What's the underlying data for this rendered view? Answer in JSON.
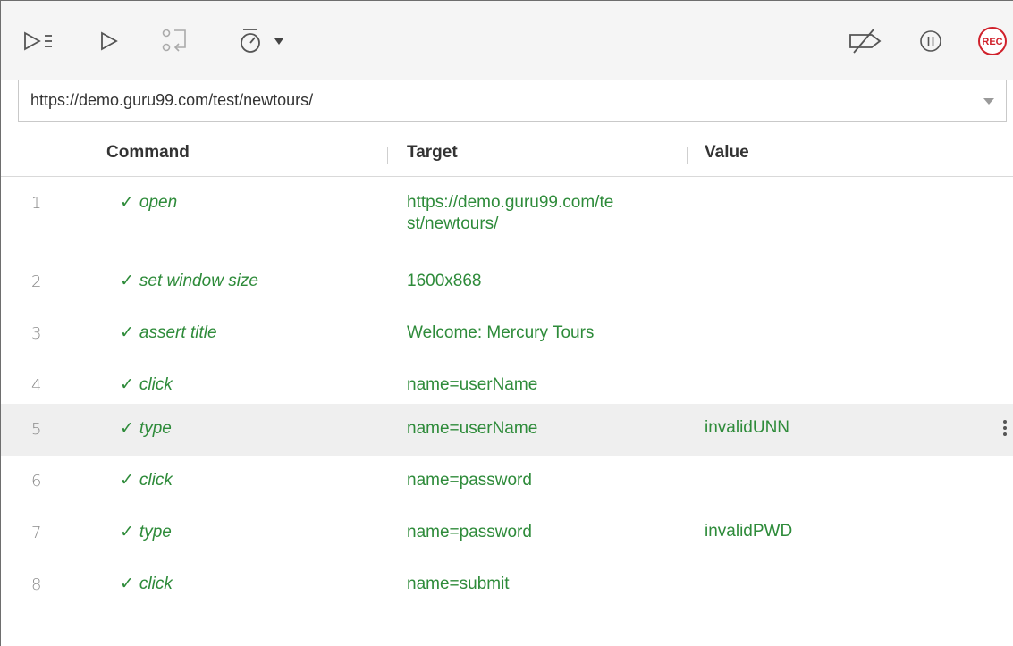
{
  "toolbar": {
    "run_all_icon": "run-all-tests-icon",
    "run_icon": "run-current-test-icon",
    "step_icon": "step-over-icon",
    "speed_icon": "test-speed-icon",
    "breakpoints_icon": "disable-breakpoints-icon",
    "pause_icon": "pause-on-exceptions-icon",
    "record_label": "REC",
    "record_color": "#d0212b"
  },
  "url_bar": {
    "value": "https://demo.guru99.com/test/newtours/"
  },
  "table": {
    "headers": {
      "command": "Command",
      "target": "Target",
      "value": "Value"
    },
    "rows": [
      {
        "num": "1",
        "check": "✓",
        "command": "open",
        "target": "https://demo.guru99.com/te\nst/newtours/",
        "value": ""
      },
      {
        "num": "2",
        "check": "✓",
        "command": "set window size",
        "target": "1600x868",
        "value": ""
      },
      {
        "num": "3",
        "check": "✓",
        "command": "assert title",
        "target": "Welcome: Mercury Tours",
        "value": ""
      },
      {
        "num": "4",
        "check": "✓",
        "command": "click",
        "target": "name=userName",
        "value": ""
      },
      {
        "num": "5",
        "check": "✓",
        "command": "type",
        "target": "name=userName",
        "value": "invalidUNN"
      },
      {
        "num": "6",
        "check": "✓",
        "command": "click",
        "target": "name=password",
        "value": ""
      },
      {
        "num": "7",
        "check": "✓",
        "command": "type",
        "target": "name=password",
        "value": "invalidPWD"
      },
      {
        "num": "8",
        "check": "✓",
        "command": "click",
        "target": "name=submit",
        "value": ""
      }
    ],
    "success_color": "#2e8b3a",
    "selected_row": 5
  }
}
